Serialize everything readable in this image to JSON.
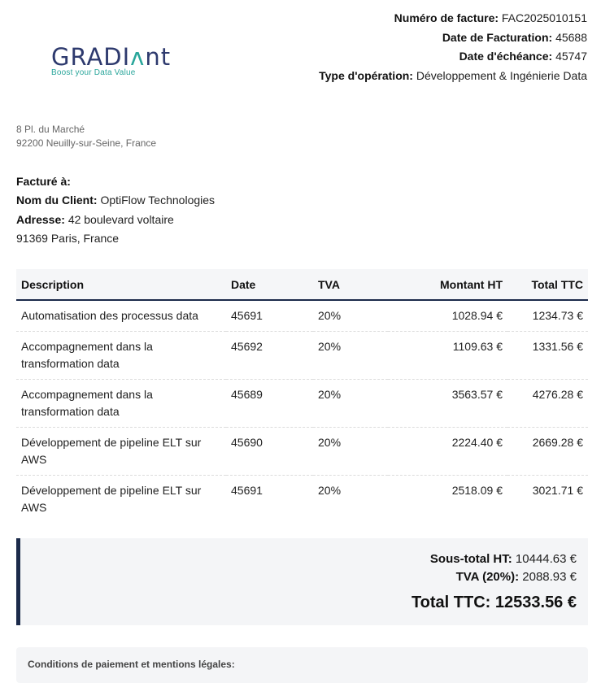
{
  "logo": {
    "text_main": "GRADI",
    "text_accent": "ʌ",
    "text_end": "nt",
    "tagline": "Boost your Data Value"
  },
  "invoice": {
    "number_label": "Numéro de facture:",
    "number": "FAC2025010151",
    "date_label": "Date de Facturation:",
    "date": "45688",
    "due_label": "Date d'échéance:",
    "due": "45747",
    "operation_label": "Type d'opération:",
    "operation": "Développement & Ingénierie Data"
  },
  "company": {
    "address_line1": "8 Pl. du Marché",
    "address_line2": "92200 Neuilly-sur-Seine, France"
  },
  "client": {
    "billed_to_label": "Facturé à:",
    "name_label": "Nom du Client:",
    "name": "OptiFlow Technologies",
    "address_label": "Adresse:",
    "address_line1": "42 boulevard voltaire",
    "address_line2": "91369 Paris, France"
  },
  "table": {
    "headers": [
      "Description",
      "Date",
      "TVA",
      "Montant HT",
      "Total TTC"
    ],
    "rows": [
      {
        "description": "Automatisation des processus data",
        "date": "45691",
        "tva": "20%",
        "ht": "1028.94 €",
        "ttc": "1234.73 €"
      },
      {
        "description": "Accompagnement dans la transformation data",
        "date": "45692",
        "tva": "20%",
        "ht": "1109.63 €",
        "ttc": "1331.56 €"
      },
      {
        "description": "Accompagnement dans la transformation data",
        "date": "45689",
        "tva": "20%",
        "ht": "3563.57 €",
        "ttc": "4276.28 €"
      },
      {
        "description": "Développement de pipeline ELT sur AWS",
        "date": "45690",
        "tva": "20%",
        "ht": "2224.40 €",
        "ttc": "2669.28 €"
      },
      {
        "description": "Développement de pipeline ELT sur AWS",
        "date": "45691",
        "tva": "20%",
        "ht": "2518.09 €",
        "ttc": "3021.71 €"
      }
    ]
  },
  "totals": {
    "subtotal_label": "Sous-total HT:",
    "subtotal": "10444.63 €",
    "tva_label": "TVA (20%):",
    "tva": "2088.93 €",
    "total_label": "Total TTC:",
    "total": "12533.56 €"
  },
  "conditions": {
    "label": "Conditions de paiement et mentions légales:"
  },
  "colors": {
    "brand_navy": "#2e3a6e",
    "brand_teal": "#2aa69b",
    "accent_border": "#1b2a4a"
  }
}
